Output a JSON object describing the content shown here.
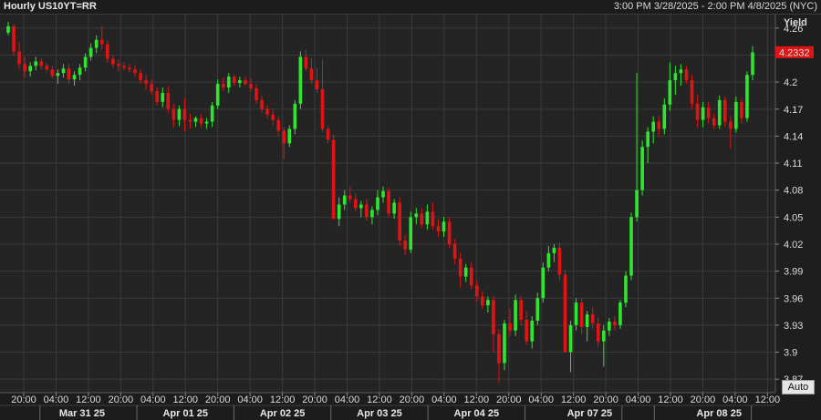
{
  "title": "Hourly US10YT=RR",
  "date_range": "3:00 PM 3/28/2025 - 2:00 PM 4/8/2025 (NYC)",
  "auto_label": "Auto",
  "colors": {
    "up": "#2ee62e",
    "down": "#e01414",
    "last_price_bg": "#e01414",
    "background": "#262626",
    "grid": "#3a3a3a"
  },
  "chart_data": {
    "type": "candlestick",
    "ylabel": "Yield",
    "ylim": [
      3.855,
      4.275
    ],
    "y_ticks": [
      4.26,
      4.23,
      4.2,
      4.17,
      4.14,
      4.11,
      4.08,
      4.05,
      4.02,
      3.99,
      3.96,
      3.93,
      3.9,
      3.87
    ],
    "y_tick_labels": [
      "4.26",
      "",
      "4.2",
      "4.17",
      "4.14",
      "4.11",
      "4.08",
      "4.05",
      "4.02",
      "3.99",
      "3.96",
      "3.93",
      "3.9",
      "3.87"
    ],
    "last_price": 4.2332,
    "last_price_label": "4.2332",
    "time_ticks": [
      "20:00",
      "04:00",
      "12:00",
      "20:00",
      "04:00",
      "12:00",
      "20:00",
      "04:00",
      "12:00",
      "20:00",
      "04:00",
      "12:00",
      "20:00",
      "04:00",
      "12:00",
      "20:00",
      "04:00",
      "12:00",
      "20:00",
      "04:00",
      "12:00",
      "20:00",
      "04:00",
      "12:00"
    ],
    "day_labels": [
      "Mar 31 25",
      "Apr 01 25",
      "Apr 02 25",
      "Apr 03 25",
      "Apr 04 25",
      "Apr 07 25",
      "Apr 08 25"
    ],
    "grid": true,
    "candles": [
      [
        4.255,
        4.267,
        4.252,
        4.262
      ],
      [
        4.262,
        4.264,
        4.23,
        4.234
      ],
      [
        4.234,
        4.245,
        4.214,
        4.22
      ],
      [
        4.22,
        4.228,
        4.205,
        4.212
      ],
      [
        4.212,
        4.222,
        4.206,
        4.218
      ],
      [
        4.218,
        4.228,
        4.213,
        4.223
      ],
      [
        4.223,
        4.227,
        4.214,
        4.218
      ],
      [
        4.218,
        4.221,
        4.211,
        4.214
      ],
      [
        4.214,
        4.218,
        4.204,
        4.207
      ],
      [
        4.207,
        4.214,
        4.198,
        4.21
      ],
      [
        4.21,
        4.22,
        4.205,
        4.215
      ],
      [
        4.215,
        4.22,
        4.198,
        4.203
      ],
      [
        4.203,
        4.212,
        4.196,
        4.208
      ],
      [
        4.208,
        4.22,
        4.202,
        4.216
      ],
      [
        4.216,
        4.232,
        4.212,
        4.228
      ],
      [
        4.228,
        4.243,
        4.224,
        4.238
      ],
      [
        4.238,
        4.252,
        4.232,
        4.247
      ],
      [
        4.247,
        4.262,
        4.236,
        4.242
      ],
      [
        4.242,
        4.246,
        4.222,
        4.226
      ],
      [
        4.226,
        4.23,
        4.216,
        4.22
      ],
      [
        4.22,
        4.225,
        4.212,
        4.218
      ],
      [
        4.218,
        4.222,
        4.213,
        4.216
      ],
      [
        4.216,
        4.22,
        4.211,
        4.214
      ],
      [
        4.214,
        4.219,
        4.206,
        4.21
      ],
      [
        4.21,
        4.214,
        4.198,
        4.202
      ],
      [
        4.202,
        4.208,
        4.192,
        4.198
      ],
      [
        4.198,
        4.203,
        4.186,
        4.19
      ],
      [
        4.19,
        4.194,
        4.174,
        4.178
      ],
      [
        4.178,
        4.194,
        4.172,
        4.188
      ],
      [
        4.188,
        4.195,
        4.166,
        4.17
      ],
      [
        4.17,
        4.176,
        4.15,
        4.158
      ],
      [
        4.158,
        4.174,
        4.151,
        4.17
      ],
      [
        4.17,
        4.182,
        4.145,
        4.158
      ],
      [
        4.158,
        4.165,
        4.148,
        4.156
      ],
      [
        4.156,
        4.162,
        4.15,
        4.16
      ],
      [
        4.16,
        4.164,
        4.15,
        4.154
      ],
      [
        4.154,
        4.16,
        4.148,
        4.156
      ],
      [
        4.156,
        4.178,
        4.15,
        4.174
      ],
      [
        4.174,
        4.203,
        4.17,
        4.198
      ],
      [
        4.198,
        4.205,
        4.19,
        4.194
      ],
      [
        4.194,
        4.21,
        4.188,
        4.206
      ],
      [
        4.206,
        4.208,
        4.196,
        4.199
      ],
      [
        4.199,
        4.206,
        4.194,
        4.202
      ],
      [
        4.202,
        4.206,
        4.196,
        4.198
      ],
      [
        4.198,
        4.204,
        4.19,
        4.193
      ],
      [
        4.193,
        4.198,
        4.176,
        4.18
      ],
      [
        4.18,
        4.185,
        4.166,
        4.17
      ],
      [
        4.17,
        4.174,
        4.16,
        4.164
      ],
      [
        4.164,
        4.17,
        4.152,
        4.158
      ],
      [
        4.158,
        4.162,
        4.14,
        4.146
      ],
      [
        4.146,
        4.15,
        4.114,
        4.132
      ],
      [
        4.132,
        4.152,
        4.128,
        4.148
      ],
      [
        4.148,
        4.18,
        4.142,
        4.176
      ],
      [
        4.176,
        4.234,
        4.17,
        4.228
      ],
      [
        4.228,
        4.236,
        4.212,
        4.215
      ],
      [
        4.215,
        4.226,
        4.198,
        4.202
      ],
      [
        4.202,
        4.216,
        4.188,
        4.192
      ],
      [
        4.192,
        4.225,
        4.145,
        4.148
      ],
      [
        4.148,
        4.152,
        4.132,
        4.136
      ],
      [
        4.136,
        4.142,
        4.074,
        4.048
      ],
      [
        4.048,
        4.072,
        4.04,
        4.064
      ],
      [
        4.064,
        4.08,
        4.058,
        4.074
      ],
      [
        4.074,
        4.084,
        4.066,
        4.07
      ],
      [
        4.07,
        4.076,
        4.056,
        4.06
      ],
      [
        4.06,
        4.068,
        4.05,
        4.064
      ],
      [
        4.064,
        4.07,
        4.046,
        4.05
      ],
      [
        4.05,
        4.062,
        4.042,
        4.058
      ],
      [
        4.058,
        4.08,
        4.052,
        4.072
      ],
      [
        4.072,
        4.084,
        4.066,
        4.079
      ],
      [
        4.079,
        4.082,
        4.05,
        4.054
      ],
      [
        4.054,
        4.07,
        4.048,
        4.066
      ],
      [
        4.066,
        4.072,
        4.018,
        4.024
      ],
      [
        4.024,
        4.03,
        4.008,
        4.014
      ],
      [
        4.014,
        4.056,
        4.01,
        4.05
      ],
      [
        4.05,
        4.06,
        4.042,
        4.054
      ],
      [
        4.054,
        4.06,
        4.038,
        4.042
      ],
      [
        4.042,
        4.064,
        4.036,
        4.056
      ],
      [
        4.056,
        4.066,
        4.036,
        4.04
      ],
      [
        4.04,
        4.048,
        4.028,
        4.034
      ],
      [
        4.034,
        4.05,
        4.028,
        4.045
      ],
      [
        4.045,
        4.05,
        4.016,
        4.02
      ],
      [
        4.02,
        4.026,
        3.998,
        4.004
      ],
      [
        4.004,
        4.01,
        3.972,
        3.984
      ],
      [
        3.984,
        3.998,
        3.978,
        3.994
      ],
      [
        3.994,
        4.0,
        3.97,
        3.974
      ],
      [
        3.974,
        3.98,
        3.956,
        3.962
      ],
      [
        3.962,
        3.968,
        3.948,
        3.952
      ],
      [
        3.952,
        3.962,
        3.944,
        3.958
      ],
      [
        3.958,
        3.962,
        3.9,
        3.92
      ],
      [
        3.92,
        3.926,
        3.866,
        3.888
      ],
      [
        3.888,
        3.936,
        3.88,
        3.932
      ],
      [
        3.932,
        3.948,
        3.918,
        3.924
      ],
      [
        3.924,
        3.964,
        3.918,
        3.958
      ],
      [
        3.958,
        3.962,
        3.93,
        3.936
      ],
      [
        3.936,
        3.946,
        3.908,
        3.912
      ],
      [
        3.912,
        3.94,
        3.904,
        3.935
      ],
      [
        3.935,
        3.966,
        3.93,
        3.96
      ],
      [
        3.96,
        4.0,
        3.955,
        3.994
      ],
      [
        3.994,
        4.018,
        3.99,
        4.01
      ],
      [
        4.01,
        4.02,
        4.0,
        4.016
      ],
      [
        4.016,
        4.022,
        3.98,
        3.986
      ],
      [
        3.986,
        3.992,
        3.93,
        3.9
      ],
      [
        3.9,
        3.935,
        3.878,
        3.93
      ],
      [
        3.93,
        3.96,
        3.924,
        3.955
      ],
      [
        3.955,
        3.96,
        3.92,
        3.928
      ],
      [
        3.928,
        3.946,
        3.912,
        3.942
      ],
      [
        3.942,
        3.95,
        3.926,
        3.932
      ],
      [
        3.932,
        3.938,
        3.906,
        3.912
      ],
      [
        3.912,
        3.93,
        3.884,
        3.924
      ],
      [
        3.924,
        3.938,
        3.918,
        3.934
      ],
      [
        3.934,
        3.94,
        3.924,
        3.93
      ],
      [
        3.93,
        3.958,
        3.926,
        3.955
      ],
      [
        3.955,
        3.99,
        3.95,
        3.985
      ],
      [
        3.985,
        4.055,
        3.98,
        4.05
      ],
      [
        4.05,
        4.21,
        4.045,
        4.08
      ],
      [
        4.08,
        4.135,
        4.074,
        4.128
      ],
      [
        4.128,
        4.15,
        4.11,
        4.145
      ],
      [
        4.145,
        4.162,
        4.132,
        4.156
      ],
      [
        4.156,
        4.162,
        4.14,
        4.148
      ],
      [
        4.148,
        4.182,
        4.142,
        4.175
      ],
      [
        4.175,
        4.222,
        4.168,
        4.202
      ],
      [
        4.202,
        4.218,
        4.186,
        4.21
      ],
      [
        4.21,
        4.22,
        4.196,
        4.214
      ],
      [
        4.214,
        4.218,
        4.198,
        4.202
      ],
      [
        4.202,
        4.208,
        4.17,
        4.176
      ],
      [
        4.176,
        4.186,
        4.15,
        4.158
      ],
      [
        4.158,
        4.178,
        4.15,
        4.172
      ],
      [
        4.172,
        4.178,
        4.154,
        4.16
      ],
      [
        4.16,
        4.165,
        4.148,
        4.152
      ],
      [
        4.152,
        4.185,
        4.148,
        4.18
      ],
      [
        4.18,
        4.184,
        4.15,
        4.156
      ],
      [
        4.156,
        4.162,
        4.126,
        4.148
      ],
      [
        4.148,
        4.184,
        4.144,
        4.178
      ],
      [
        4.178,
        4.182,
        4.154,
        4.16
      ],
      [
        4.16,
        4.212,
        4.156,
        4.208
      ],
      [
        4.208,
        4.24,
        4.202,
        4.233
      ]
    ]
  }
}
